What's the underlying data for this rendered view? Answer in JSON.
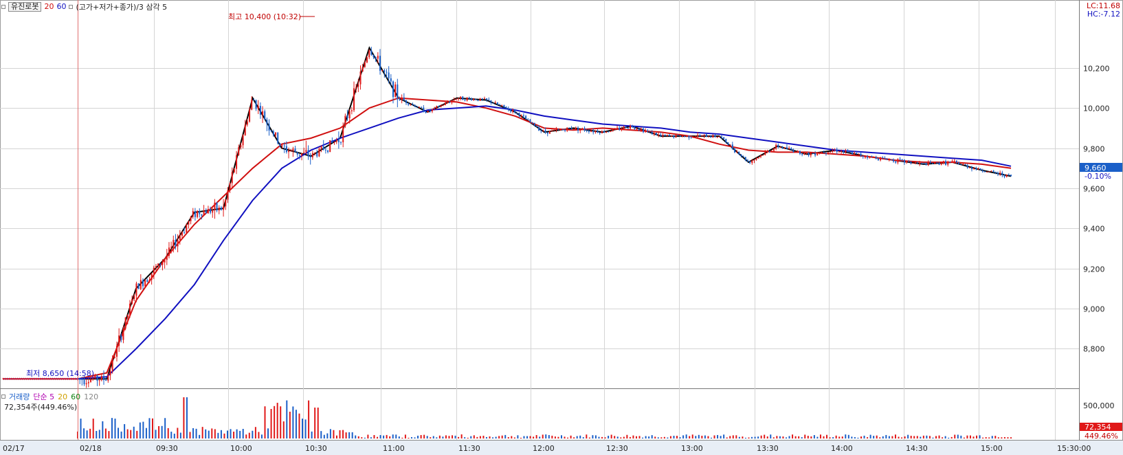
{
  "legend": {
    "stock_name": "유진로봇",
    "ma1": "20",
    "ma2": "60",
    "pivot_label": "(고가+저가+종가)/3 삼각 5",
    "ma1_color": "#d01010",
    "ma2_color": "#1010c0"
  },
  "corner": {
    "lc": "LC:11.68",
    "hc": "HC:-7.12"
  },
  "annotations": {
    "high": "최고 10,400 (10:32)",
    "low": "최저 8,650 (14:58)"
  },
  "last_price": {
    "value": "9,660",
    "change": "-0.10%",
    "price": 9660
  },
  "volume_panel": {
    "title": "거래량",
    "ma_label": "단순 5",
    "ma20": "20",
    "ma60": "60",
    "ma120": "120",
    "current": "72,354주(449.46%)",
    "last_value": "72,354",
    "last_pct": "449.46%",
    "axis_label": "500,000"
  },
  "colors": {
    "up": "#e01818",
    "down": "#1a5fc8",
    "grid": "#d4d4d4",
    "ma_black": "#000000",
    "ma_red": "#d01010",
    "ma_blue": "#1010c0"
  },
  "chart_data": {
    "type": "candlestick",
    "y_ticks": [
      "10,200",
      "10,000",
      "9,800",
      "9,600",
      "9,400",
      "9,200",
      "9,000",
      "8,800"
    ],
    "y_values": [
      10200,
      10000,
      9800,
      9600,
      9400,
      9200,
      9000,
      8800
    ],
    "x_ticks": [
      "02/17",
      "02/18",
      "09:30",
      "10:00",
      "10:30",
      "11:00",
      "11:30",
      "12:00",
      "12:30",
      "13:00",
      "13:30",
      "14:00",
      "14:30",
      "15:00",
      "15:30:00"
    ],
    "ylim": [
      8620,
      10470
    ],
    "series": [
      {
        "name": "20",
        "values": [
          8650,
          8680,
          9040,
          9250,
          9420,
          9560,
          9700,
          9820,
          9850,
          9900,
          10000,
          10050,
          10040,
          10030,
          10000,
          9960,
          9900,
          9890,
          9900,
          9890,
          9880,
          9860,
          9820,
          9790,
          9780,
          9780,
          9770,
          9760,
          9740,
          9730,
          9730,
          9720,
          9700
        ]
      },
      {
        "name": "60",
        "values": [
          8650,
          8660,
          8800,
          8950,
          9120,
          9340,
          9540,
          9700,
          9790,
          9850,
          9900,
          9950,
          9990,
          10000,
          10010,
          9990,
          9960,
          9940,
          9920,
          9910,
          9900,
          9880,
          9870,
          9850,
          9830,
          9810,
          9790,
          9780,
          9770,
          9760,
          9750,
          9740,
          9710
        ]
      }
    ],
    "price_path": [
      8650,
      8650,
      9100,
      9250,
      9480,
      9500,
      10050,
      9800,
      9760,
      9850,
      10300,
      10050,
      9980,
      10050,
      10040,
      9980,
      9880,
      9900,
      9880,
      9910,
      9860,
      9860,
      9860,
      9730,
      9810,
      9770,
      9790,
      9760,
      9740,
      9720,
      9730,
      9690,
      9660
    ]
  }
}
